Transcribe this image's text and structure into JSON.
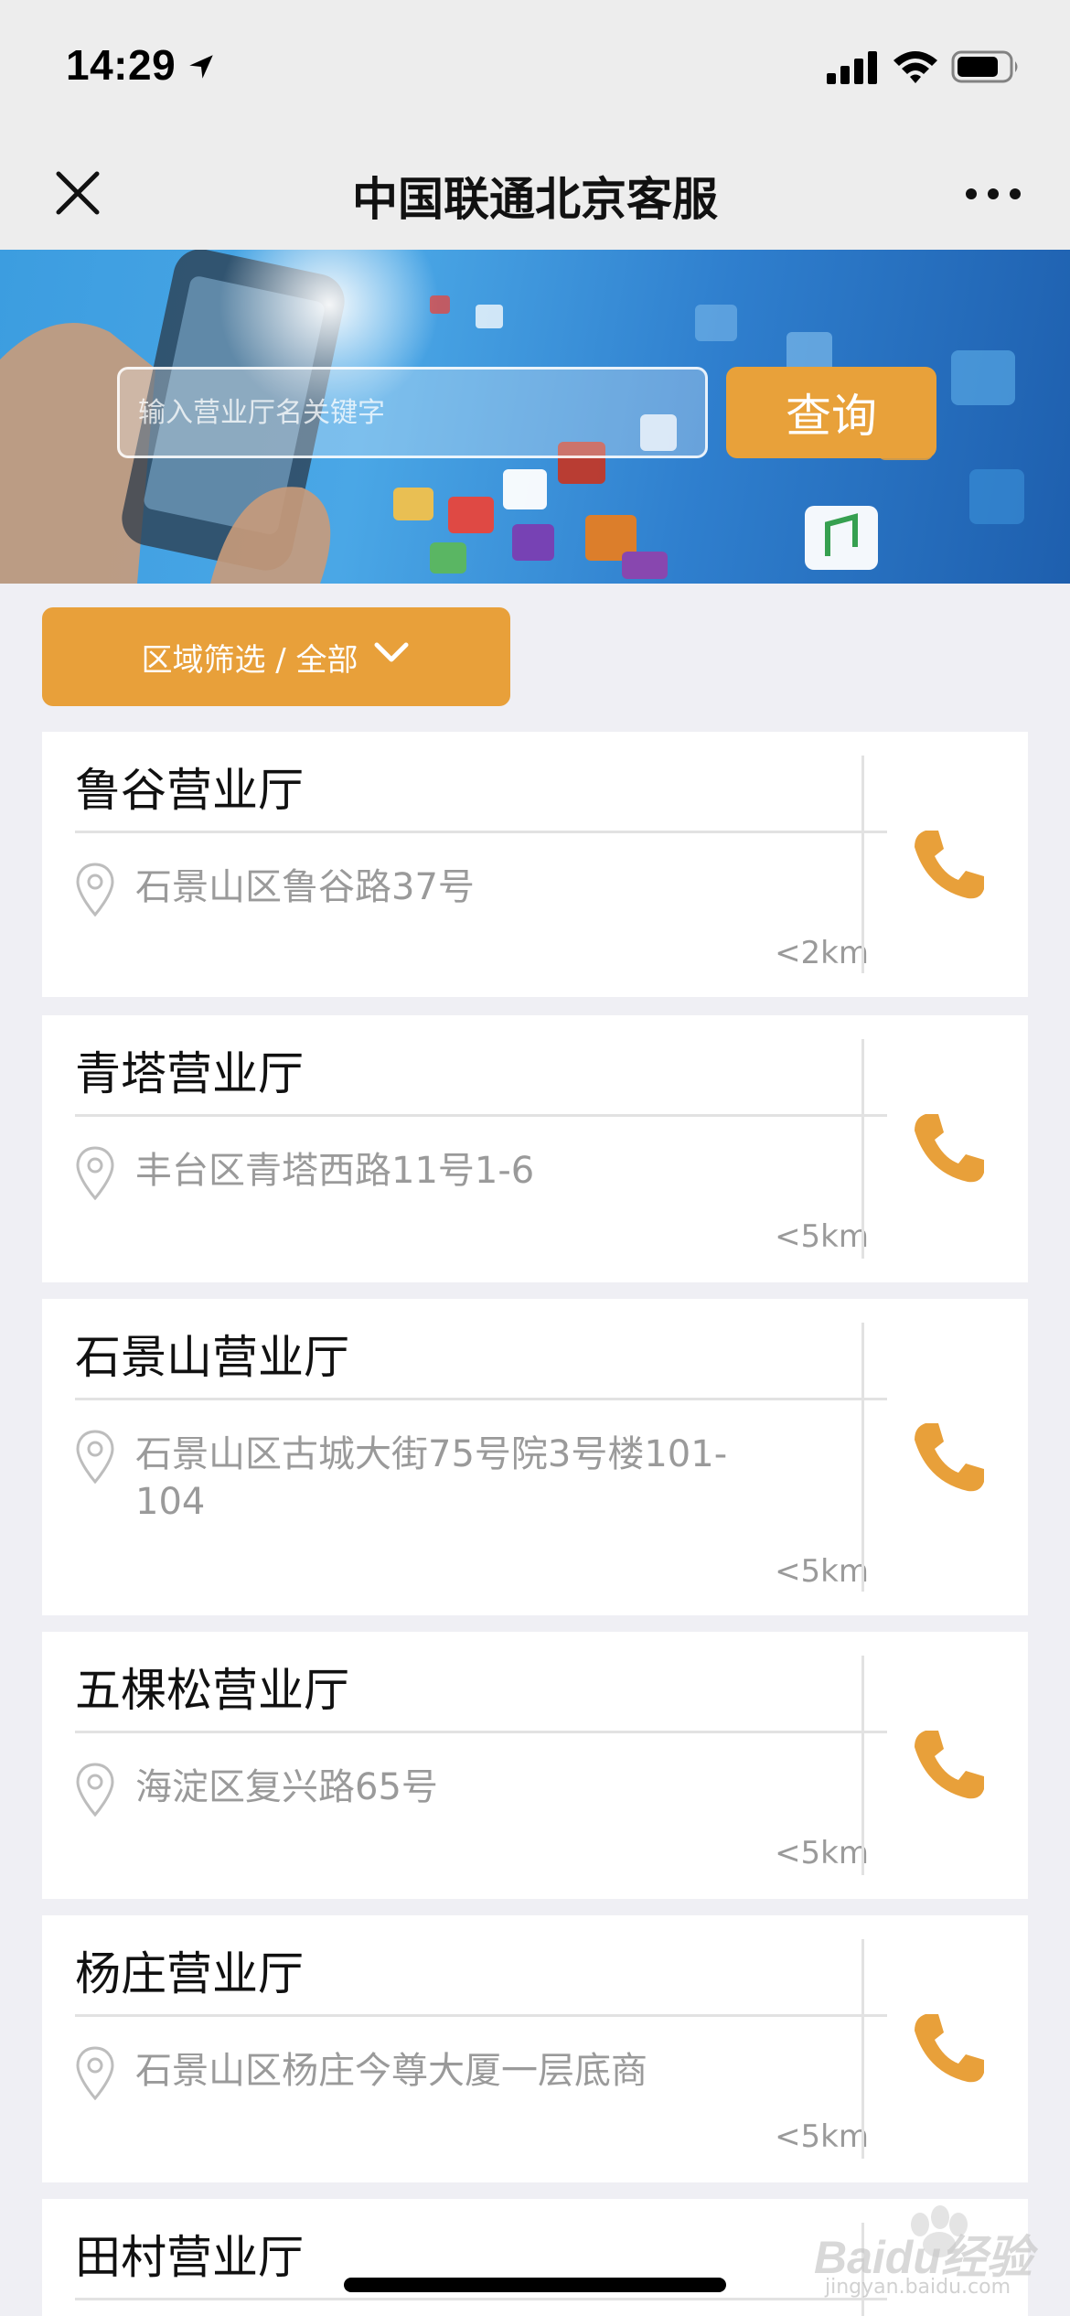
{
  "status_bar": {
    "time": "14:29"
  },
  "nav": {
    "title": "中国联通北京客服"
  },
  "search": {
    "placeholder": "输入营业厅名关键字",
    "button_label": "查询"
  },
  "filter": {
    "label": "区域筛选 / 全部"
  },
  "stores": [
    {
      "name": "鲁谷营业厅",
      "address": "石景山区鲁谷路37号",
      "distance": "<2km"
    },
    {
      "name": "青塔营业厅",
      "address": "丰台区青塔西路11号1-6",
      "distance": "<5km"
    },
    {
      "name": "石景山营业厅",
      "address": "石景山区古城大街75号院3号楼101-104",
      "distance": "<5km"
    },
    {
      "name": "五棵松营业厅",
      "address": "海淀区复兴路65号",
      "distance": "<5km"
    },
    {
      "name": "杨庄营业厅",
      "address": "石景山区杨庄今尊大厦一层底商",
      "distance": "<5km"
    },
    {
      "name": "田村营业厅",
      "address": "",
      "distance": ""
    }
  ],
  "watermark": {
    "text": "Baidu经验",
    "sub": "jingyan.baidu.com"
  },
  "colors": {
    "accent": "#e8a03a",
    "background": "#efeff4",
    "nav_bg": "#ededed"
  }
}
